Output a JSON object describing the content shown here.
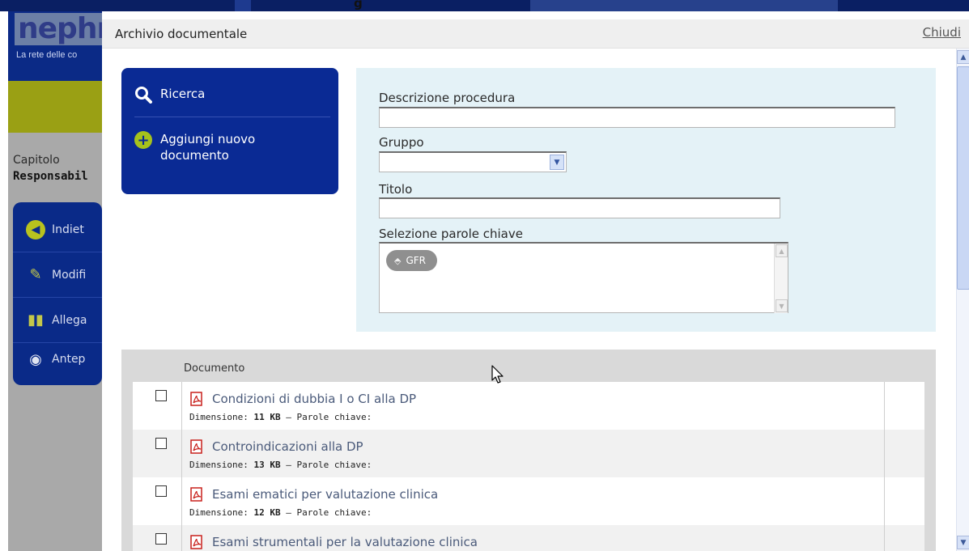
{
  "background": {
    "logo_text": "nephr",
    "logo_subtitle": "La rete delle co",
    "capitolo_label": "Capitolo",
    "capitolo_value": "Responsabil",
    "nav": [
      {
        "label": "Indiet",
        "icon": "back-arrow-icon"
      },
      {
        "label": "Modifi",
        "icon": "pencil-icon"
      },
      {
        "label": "Allega",
        "icon": "books-icon"
      },
      {
        "label": "Antep",
        "icon": "eye-icon"
      }
    ],
    "top_title_fragment": "g"
  },
  "modal": {
    "title": "Archivio documentale",
    "close_label": "Chiudi"
  },
  "actions": {
    "search_label": "Ricerca",
    "add_label": "Aggiungi nuovo documento"
  },
  "search": {
    "descrizione_label": "Descrizione procedura",
    "descrizione_value": "",
    "gruppo_label": "Gruppo",
    "gruppo_value": "",
    "titolo_label": "Titolo",
    "titolo_value": "",
    "keywords_label": "Selezione parole chiave",
    "keywords": [
      "GFR"
    ]
  },
  "documents": {
    "column_header": "Documento",
    "size_label": "Dimensione:",
    "keywords_label": "Parole chiave:",
    "rows": [
      {
        "title": "Condizioni di dubbia I o CI alla DP",
        "size": "11 KB"
      },
      {
        "title": "Controindicazioni alla DP",
        "size": "13 KB"
      },
      {
        "title": "Esami ematici per valutazione clinica",
        "size": "12 KB"
      },
      {
        "title": "Esami strumentali per la valutazione clinica",
        "size": ""
      }
    ]
  },
  "colors": {
    "modal_header_bg": "#efefef",
    "action_box": "#0a2a94",
    "form_bg": "#e4f2f7",
    "search_icon": "#ffffff",
    "add_icon": "#a6c21c",
    "link_text": "#4a5a7a",
    "pdf_icon": "#c8201c"
  }
}
